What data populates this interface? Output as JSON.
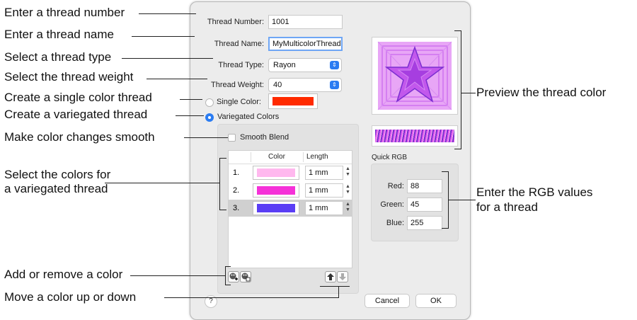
{
  "callouts": {
    "thread_number": "Enter a thread number",
    "thread_name": "Enter a thread name",
    "thread_type": "Select a thread type",
    "thread_weight": "Select the thread weight",
    "single_color": "Create a single color thread",
    "variegated": "Create a variegated thread",
    "smooth": "Make color changes smooth",
    "select_colors_line1": "Select the colors for",
    "select_colors_line2": "a variegated thread",
    "add_remove": "Add or remove a color",
    "move": "Move a color up or down",
    "preview": "Preview the thread color",
    "rgb_line1": "Enter the RGB values",
    "rgb_line2": "for a thread"
  },
  "dialog": {
    "thread_number": {
      "label": "Thread Number:",
      "value": "1001"
    },
    "thread_name": {
      "label": "Thread Name:",
      "value": "MyMulticolorThread"
    },
    "thread_type": {
      "label": "Thread Type:",
      "value": "Rayon"
    },
    "thread_weight": {
      "label": "Thread Weight:",
      "value": "40"
    },
    "single_color": {
      "label": "Single Color:",
      "swatch": "#ff2a00",
      "selected": false
    },
    "variegated": {
      "label": "Variegated Colors",
      "selected": true
    },
    "smooth_blend": {
      "label": "Smooth Blend",
      "checked": false
    },
    "table": {
      "headers": [
        "Color",
        "Length"
      ],
      "rows": [
        {
          "index": "1.",
          "color": "#ffb8ee",
          "length": "1 mm"
        },
        {
          "index": "2.",
          "color": "#f531d8",
          "length": "1 mm"
        },
        {
          "index": "3.",
          "color": "#5a3ef5",
          "length": "1 mm"
        }
      ]
    },
    "quick_rgb": {
      "title": "Quick RGB",
      "red": {
        "label": "Red:",
        "value": "88"
      },
      "green": {
        "label": "Green:",
        "value": "45"
      },
      "blue": {
        "label": "Blue:",
        "value": "255"
      }
    },
    "buttons": {
      "cancel": "Cancel",
      "ok": "OK",
      "help": "?"
    },
    "accent": "#2a7cf2",
    "preview_colors": {
      "light": "#e8a6f6",
      "mid": "#c258ec",
      "dark": "#7b2ed0"
    }
  }
}
